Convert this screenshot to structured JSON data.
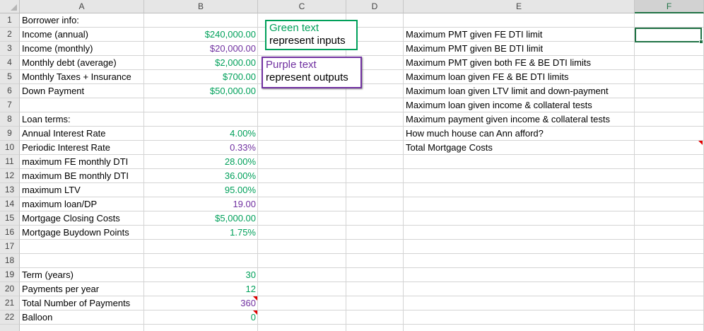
{
  "columns": [
    "A",
    "B",
    "C",
    "D",
    "E",
    "F"
  ],
  "selected_column": "F",
  "rows": [
    "1",
    "2",
    "3",
    "4",
    "5",
    "6",
    "7",
    "8",
    "9",
    "10",
    "11",
    "12",
    "13",
    "14",
    "15",
    "16",
    "17",
    "18",
    "19",
    "20",
    "21",
    "22"
  ],
  "colA": {
    "1": "Borrower info:",
    "2": "Income (annual)",
    "3": "Income (monthly)",
    "4": "Monthly debt (average)",
    "5": "Monthly Taxes + Insurance",
    "6": "Down Payment",
    "8": "Loan terms:",
    "9": "Annual Interest Rate",
    "10": "Periodic Interest Rate",
    "11": "maximum FE monthly DTI",
    "12": "maximum BE monthly DTI",
    "13": "maximum LTV",
    "14": "maximum loan/DP",
    "15": "Mortgage Closing Costs",
    "16": "Mortgage Buydown Points",
    "19": "Term (years)",
    "20": "Payments per year",
    "21": "Total Number of Payments",
    "22": "Balloon"
  },
  "colB": {
    "2": "$240,000.00",
    "3": "$20,000.00",
    "4": "$2,000.00",
    "5": "$700.00",
    "6": "$50,000.00",
    "9": "4.00%",
    "10": "0.33%",
    "11": "28.00%",
    "12": "36.00%",
    "13": "95.00%",
    "14": "19.00",
    "15": "$5,000.00",
    "16": "1.75%",
    "19": "30",
    "20": "12",
    "21": "360",
    "22": "0"
  },
  "colE": {
    "2": "Maximum PMT given FE DTI limit",
    "3": "Maximum PMT given BE DTI limit",
    "4": "Maximum PMT given both FE & BE DTI limits",
    "5": "Maximum loan given FE & BE DTI limits",
    "6": "Maximum loan given LTV limit and down-payment",
    "7": "Maximum loan given income & collateral tests",
    "8": "Maximum payment given income & collateral tests",
    "9": "How much house can Ann afford?",
    "10": "Total Mortgage Costs"
  },
  "legend": {
    "inputs_line1": "Green text",
    "inputs_line2": "represent inputs",
    "outputs_line1": "Purple text",
    "outputs_line2": "represent outputs"
  },
  "colors": {
    "input": "#00a05a",
    "output": "#7030a0",
    "selection": "#217346",
    "comment_marker": "#e00000"
  }
}
